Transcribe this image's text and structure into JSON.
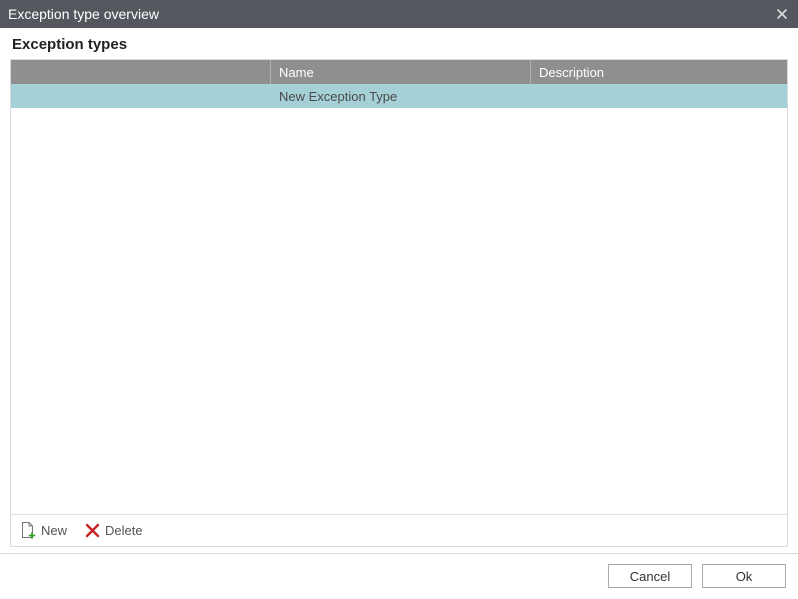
{
  "titlebar": {
    "title": "Exception type overview"
  },
  "section_title": "Exception types",
  "grid": {
    "headers": {
      "name": "Name",
      "description": "Description"
    },
    "rows": [
      {
        "name": "New Exception Type",
        "description": ""
      }
    ],
    "toolbar": {
      "new_label": "New",
      "delete_label": "Delete"
    }
  },
  "footer": {
    "cancel_label": "Cancel",
    "ok_label": "Ok"
  }
}
